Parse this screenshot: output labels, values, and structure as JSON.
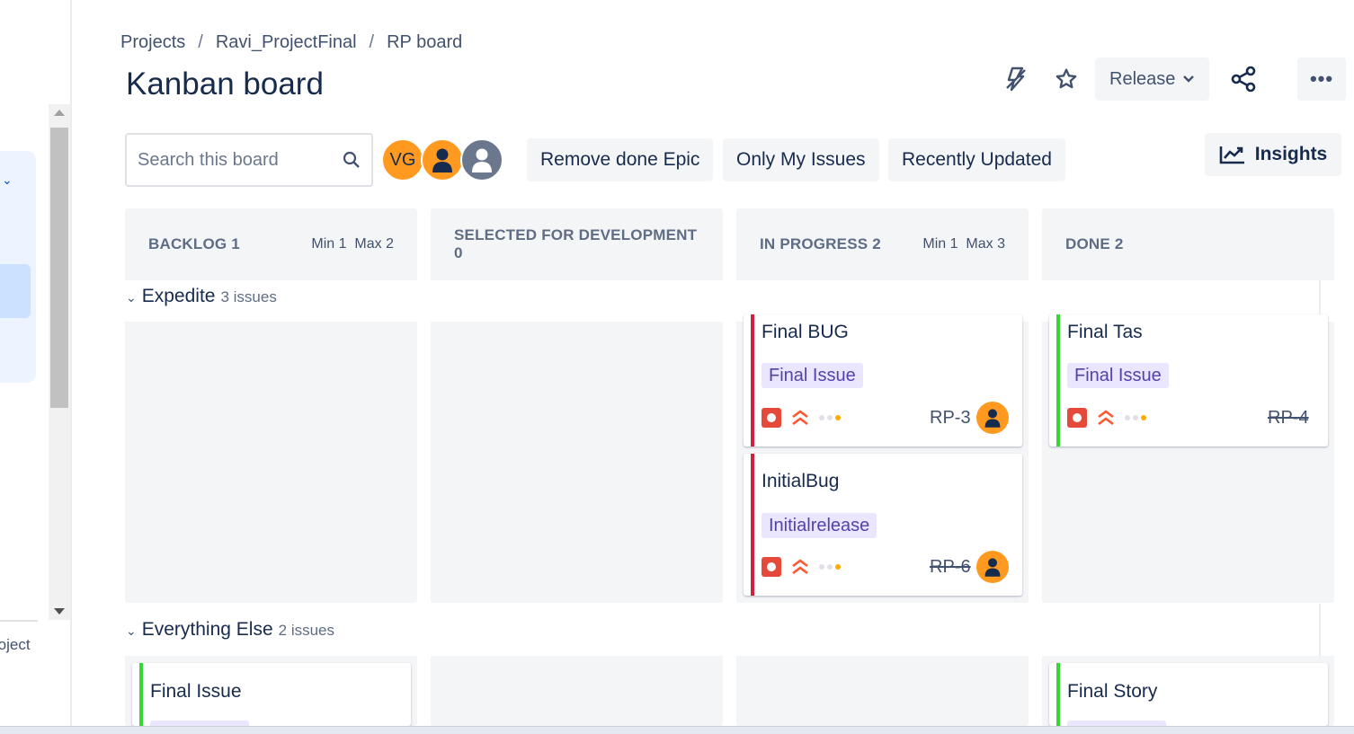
{
  "breadcrumb": {
    "items": [
      "Projects",
      "Ravi_ProjectFinal",
      "RP board"
    ],
    "separator": "/"
  },
  "page": {
    "title": "Kanban board"
  },
  "actions": {
    "release_label": "Release",
    "more_label": "•••"
  },
  "search": {
    "placeholder": "Search this board",
    "value": ""
  },
  "avatars": {
    "initials": "VG"
  },
  "filters": [
    "Remove done Epic",
    "Only My Issues",
    "Recently Updated"
  ],
  "insights_label": "Insights",
  "columns": [
    {
      "title": "BACKLOG 1",
      "min": "Min 1",
      "max": "Max 2"
    },
    {
      "title": "SELECTED FOR DEVELOPMENT 0",
      "min": "",
      "max": ""
    },
    {
      "title": "IN PROGRESS 2",
      "min": "Min 1",
      "max": "Max 3"
    },
    {
      "title": "DONE 2",
      "min": "",
      "max": ""
    }
  ],
  "swimlanes": [
    {
      "name": "Expedite",
      "count": "3 issues"
    },
    {
      "name": "Everything Else",
      "count": "2 issues"
    }
  ],
  "cards": [
    {
      "title": "Final BUG",
      "epic": "Final Issue",
      "key": "RP-3",
      "done": false,
      "bar_color": "#d1213c"
    },
    {
      "title": "InitialBug",
      "epic": "Initialrelease",
      "key": "RP-6",
      "done": true,
      "bar_color": "#d1213c"
    },
    {
      "title": "Final Tas",
      "epic": "Final Issue",
      "key": "RP-4",
      "done": true,
      "bar_color": "#36d636"
    },
    {
      "title": "Final Issue",
      "epic": "",
      "key": "",
      "done": false,
      "bar_color": "#36d636"
    },
    {
      "title": "Final Story",
      "epic": "",
      "key": "",
      "done": false,
      "bar_color": "#36d636"
    }
  ],
  "sidebar": {
    "project_text": "roject"
  },
  "icons": {
    "automation": "lightning-icon",
    "star": "star-icon",
    "release_chevron": "chevron-down-icon",
    "share": "share-icon",
    "more": "more-icon",
    "search": "search-icon",
    "insights": "chart-icon",
    "bug": "bug-icon",
    "priority": "highest-priority-icon",
    "person": "person-icon"
  },
  "colors": {
    "epic_bg": "#eae6ff",
    "epic_text": "#5243aa",
    "bug": "#e5493a",
    "priority": "#ff5630",
    "avatar": "#ff991f"
  }
}
